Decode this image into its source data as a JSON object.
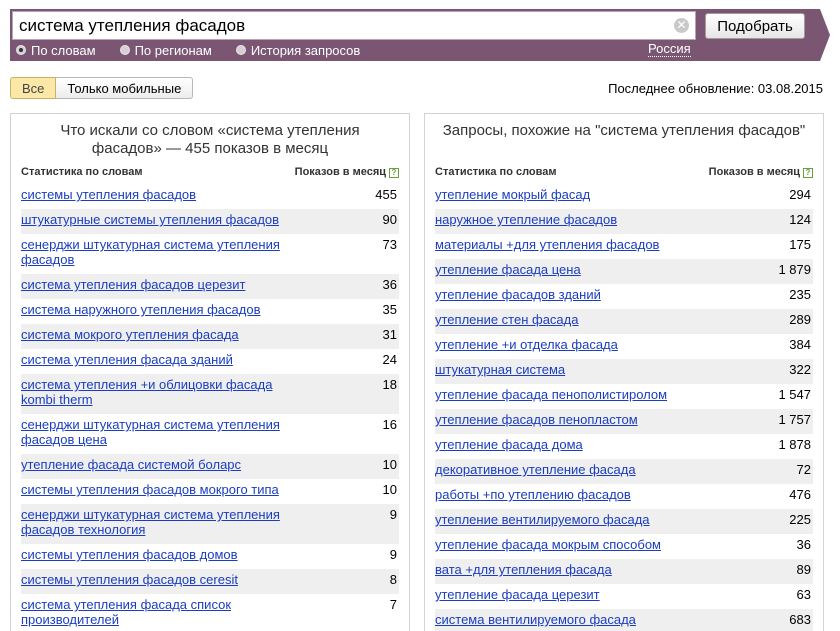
{
  "search": {
    "query": "система утепления фасадов",
    "submit_label": "Подобрать",
    "clear_icon": "✕",
    "modes": [
      {
        "label": "По словам",
        "checked": true
      },
      {
        "label": "По регионам",
        "checked": false
      },
      {
        "label": "История запросов",
        "checked": false
      }
    ],
    "region": "Россия"
  },
  "filters": {
    "all_label": "Все",
    "mobile_label": "Только мобильные"
  },
  "last_update": "Последнее обновление: 03.08.2015",
  "left_panel": {
    "title": "Что искали со словом «система утепления фасадов» — 455 показов в месяц",
    "col_phrase": "Статистика по словам",
    "col_count": "Показов в месяц",
    "help": "?",
    "rows": [
      {
        "phrase": "системы утепления фасадов",
        "count": "455"
      },
      {
        "phrase": "штукатурные системы утепления фасадов",
        "count": "90"
      },
      {
        "phrase": "сенерджи штукатурная система утепления фасадов",
        "count": "73"
      },
      {
        "phrase": "система утепления фасадов церезит",
        "count": "36"
      },
      {
        "phrase": "система наружного утепления фасадов",
        "count": "35"
      },
      {
        "phrase": "система мокрого утепления фасада",
        "count": "31"
      },
      {
        "phrase": "система утепления фасада зданий",
        "count": "24"
      },
      {
        "phrase": "система утепления +и облицовки фасада kombi therm",
        "count": "18"
      },
      {
        "phrase": "сенерджи штукатурная система утепления фасадов цена",
        "count": "16"
      },
      {
        "phrase": "утепление фасада системой боларс",
        "count": "10"
      },
      {
        "phrase": "системы утепления фасадов мокрого типа",
        "count": "10"
      },
      {
        "phrase": "сенерджи штукатурная система утепления фасадов технология",
        "count": "9"
      },
      {
        "phrase": "системы утепления фасадов домов",
        "count": "9"
      },
      {
        "phrase": "системы утепления фасадов ceresit",
        "count": "8"
      },
      {
        "phrase": "система утепления фасада список производителей",
        "count": "7"
      }
    ]
  },
  "right_panel": {
    "title": "Запросы, похожие на \"система утепления фасадов\"",
    "col_phrase": "Статистика по словам",
    "col_count": "Показов в месяц",
    "help": "?",
    "rows": [
      {
        "phrase": "утепление мокрый фасад",
        "count": "294"
      },
      {
        "phrase": "наружное утепление фасадов",
        "count": "124"
      },
      {
        "phrase": "материалы +для утепления фасадов",
        "count": "175"
      },
      {
        "phrase": "утепление фасада цена",
        "count": "1 879"
      },
      {
        "phrase": "утепление фасадов зданий",
        "count": "235"
      },
      {
        "phrase": "утепление стен фасада",
        "count": "289"
      },
      {
        "phrase": "утепление +и отделка фасада",
        "count": "384"
      },
      {
        "phrase": "штукатурная система",
        "count": "322"
      },
      {
        "phrase": "утепление фасада пенополистиролом",
        "count": "1 547"
      },
      {
        "phrase": "утепление фасадов пенопластом",
        "count": "1 757"
      },
      {
        "phrase": "утепление фасада дома",
        "count": "1 878"
      },
      {
        "phrase": "декоративное утепление фасада",
        "count": "72"
      },
      {
        "phrase": "работы +по утеплению фасадов",
        "count": "476"
      },
      {
        "phrase": "утепление вентилируемого фасада",
        "count": "225"
      },
      {
        "phrase": "утепление фасада мокрым способом",
        "count": "36"
      },
      {
        "phrase": "вата +для утепления фасада",
        "count": "89"
      },
      {
        "phrase": "утепление фасада церезит",
        "count": "63"
      },
      {
        "phrase": "система вентилируемого фасада",
        "count": "683"
      }
    ]
  }
}
